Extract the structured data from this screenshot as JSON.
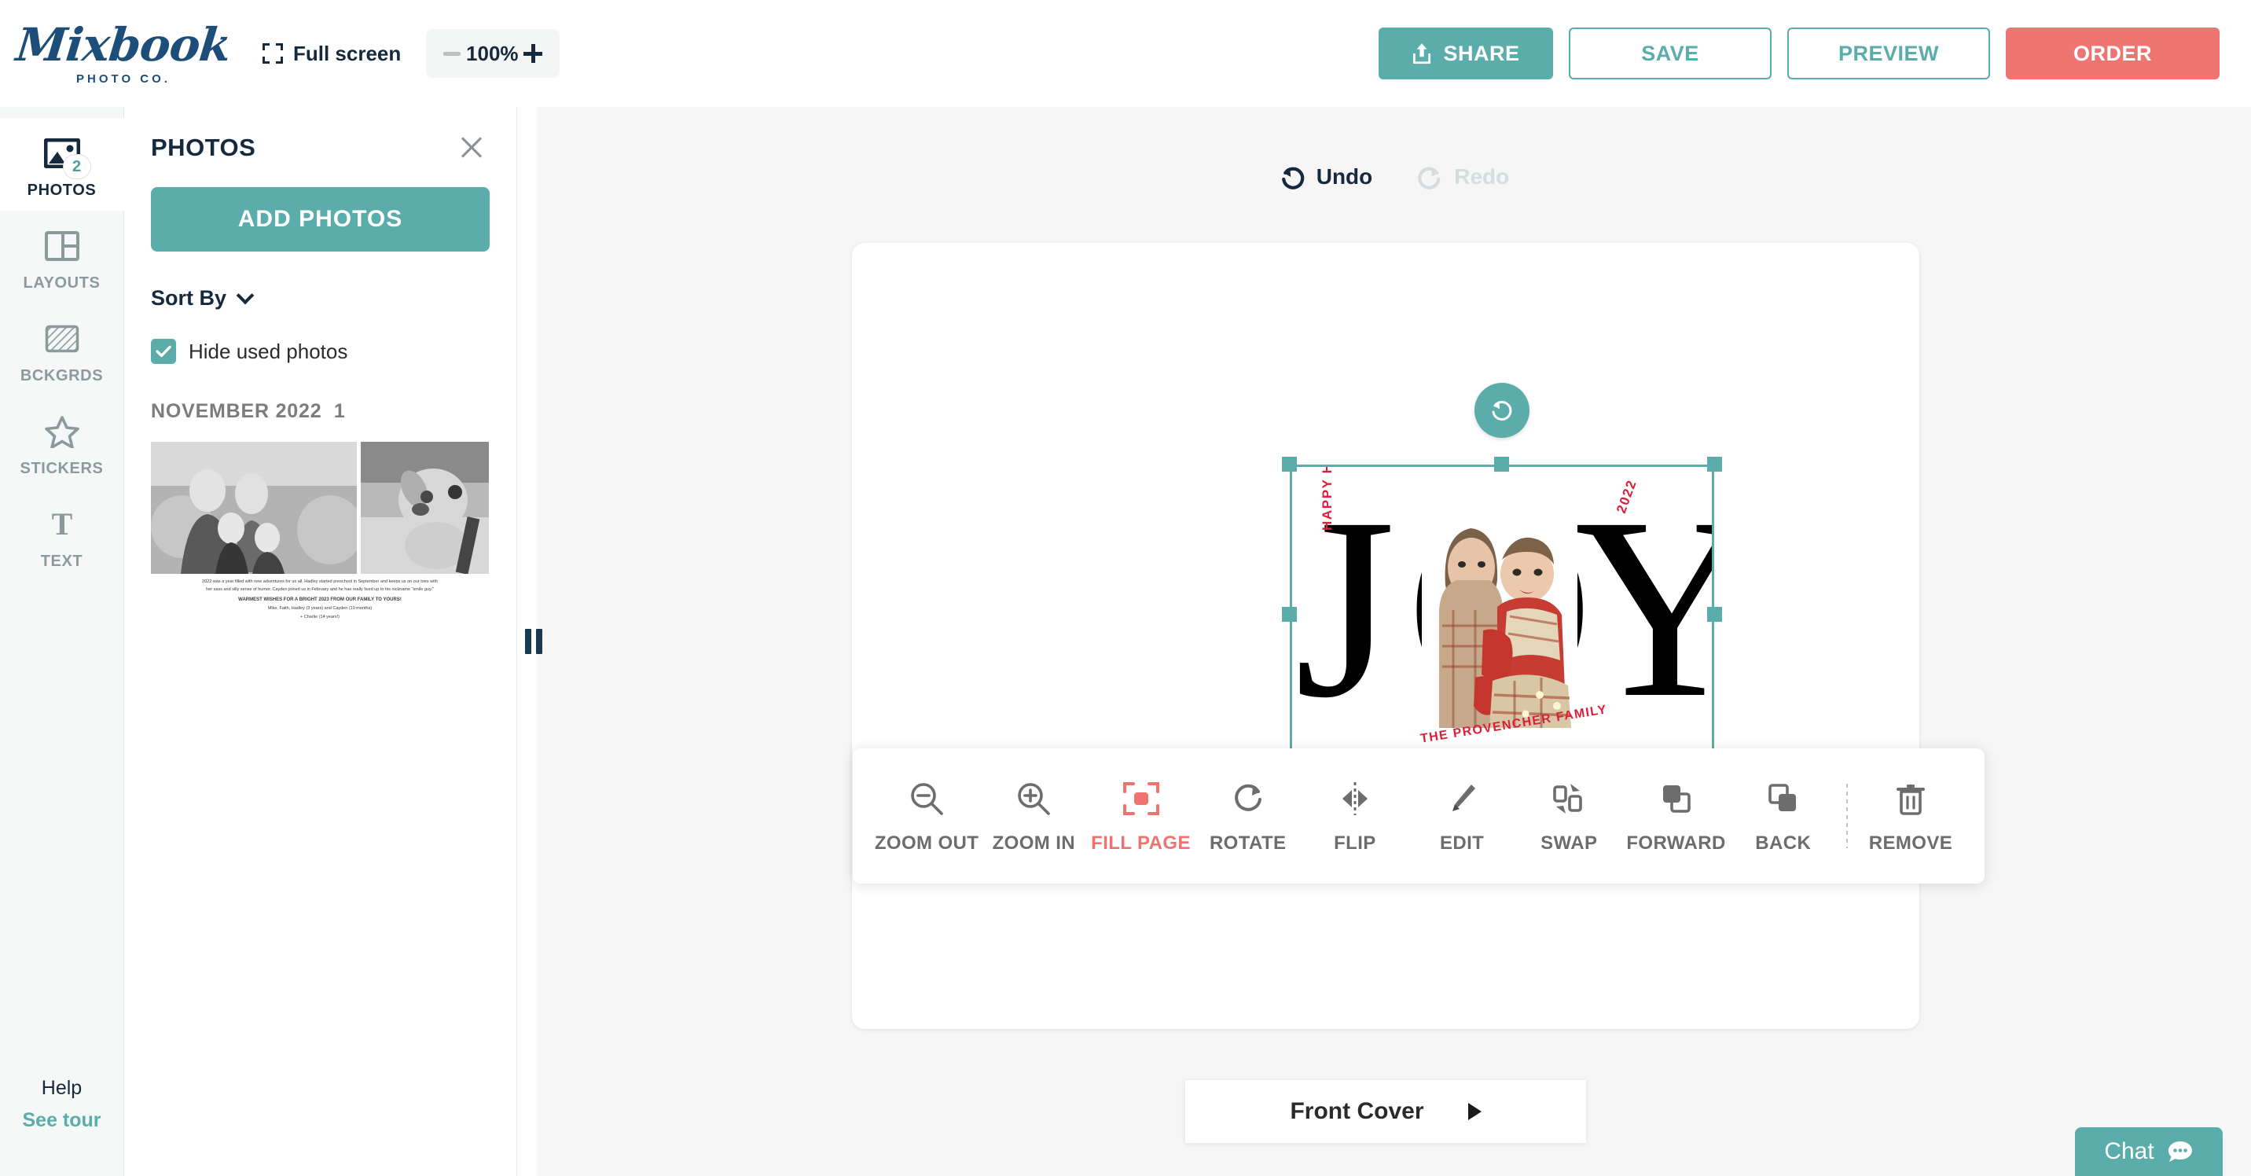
{
  "brand": {
    "logo_text": "Mixbook",
    "logo_subtitle": "PHOTO CO."
  },
  "header": {
    "fullscreen_label": "Full screen",
    "zoom_value": "100%",
    "zoom_out_icon": "minus-icon",
    "zoom_in_icon": "plus-icon",
    "share_label": "SHARE",
    "save_label": "SAVE",
    "preview_label": "PREVIEW",
    "order_label": "ORDER",
    "colors": {
      "teal": "#5aadaa",
      "coral": "#ef7573",
      "navy": "#16293d"
    }
  },
  "rail": {
    "items": [
      {
        "label": "PHOTOS",
        "icon": "photos-icon",
        "badge": "2",
        "active": true
      },
      {
        "label": "LAYOUTS",
        "icon": "layouts-icon",
        "badge": "",
        "active": false
      },
      {
        "label": "BCKGRDS",
        "icon": "backgrounds-icon",
        "badge": "",
        "active": false
      },
      {
        "label": "STICKERS",
        "icon": "star-icon",
        "badge": "",
        "active": false
      },
      {
        "label": "TEXT",
        "icon": "text-icon",
        "badge": "",
        "active": false
      }
    ],
    "help_label": "Help",
    "tour_label": "See tour"
  },
  "panel": {
    "title": "PHOTOS",
    "close_icon": "close-icon",
    "add_photos_label": "ADD PHOTOS",
    "sort_by_label": "Sort By",
    "sort_chevron_icon": "chevron-down-icon",
    "hide_used_label": "Hide used photos",
    "hide_used_checked": true,
    "group_label": "NOVEMBER 2022",
    "group_count": "1",
    "thumbnail": {
      "caption_line1": "2022 was a year filled with new adventures for us all. Hadley started preschool in September and keeps us on our toes with",
      "caption_line2": "her sass and silly sense of humor. Cayden joined us in February and he has really lived up to his nickname \"smile guy.\"",
      "caption_bold": "WARMEST WISHES FOR A BRIGHT 2023 FROM OUR FAMILY TO YOURS!",
      "caption_names": "Mike, Faith, Hadley (3 years) and Cayden (10 months)",
      "caption_pet": "+ Charlie (14 years!)"
    }
  },
  "canvas": {
    "undo_label": "Undo",
    "redo_label": "Redo",
    "undo_icon": "undo-arrow-icon",
    "redo_icon": "redo-arrow-icon",
    "rotate_handle_icon": "rotate-icon",
    "card": {
      "word": "JOY",
      "letters": [
        "J",
        "O",
        "Y"
      ],
      "greeting": "HAPPY HOLIDAYS",
      "year": "2022",
      "family": "THE PROVENCHER FAMILY",
      "accent_color": "#d9203c"
    }
  },
  "toolbar": {
    "tools": [
      {
        "label": "ZOOM OUT",
        "icon": "zoom-out-icon",
        "highlight": false
      },
      {
        "label": "ZOOM IN",
        "icon": "zoom-in-icon",
        "highlight": false
      },
      {
        "label": "FILL PAGE",
        "icon": "fill-page-icon",
        "highlight": true
      },
      {
        "label": "ROTATE",
        "icon": "rotate-cw-icon",
        "highlight": false
      },
      {
        "label": "FLIP",
        "icon": "flip-icon",
        "highlight": false
      },
      {
        "label": "EDIT",
        "icon": "brush-icon",
        "highlight": false
      },
      {
        "label": "SWAP",
        "icon": "swap-icon",
        "highlight": false
      },
      {
        "label": "FORWARD",
        "icon": "forward-icon",
        "highlight": false
      },
      {
        "label": "BACK",
        "icon": "back-icon",
        "highlight": false
      },
      {
        "label": "REMOVE",
        "icon": "trash-icon",
        "highlight": false
      }
    ]
  },
  "page_nav": {
    "label": "Front Cover",
    "arrow_icon": "triangle-right-icon"
  },
  "chat": {
    "label": "Chat",
    "icon": "chat-bubble-icon"
  }
}
